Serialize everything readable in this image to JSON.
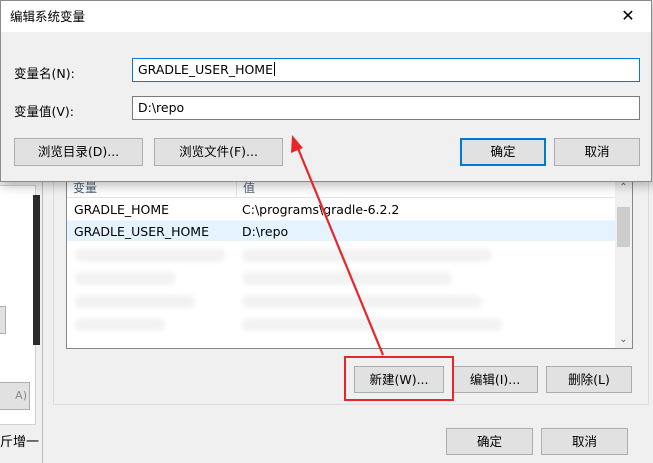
{
  "dialog": {
    "title": "编辑系统变量",
    "name_label": "变量名(N):",
    "name_value": "GRADLE_USER_HOME",
    "value_label": "变量值(V):",
    "value_value": "D:\\repo",
    "browse_dir_label": "浏览目录(D)...",
    "browse_file_label": "浏览文件(F)...",
    "ok_label": "确定",
    "cancel_label": "取消",
    "close_glyph": "✕"
  },
  "env_vars": {
    "columns": [
      "变量",
      "值"
    ],
    "rows": [
      {
        "name": "GRADLE_HOME",
        "value": "C:\\programs\\gradle-6.2.2"
      },
      {
        "name": "GRADLE_USER_HOME",
        "value": "D:\\repo"
      }
    ],
    "new_label": "新建(W)...",
    "edit_label": "编辑(I)...",
    "delete_label": "删除(L)",
    "ok_label": "确定",
    "cancel_label": "取消",
    "scroll_up": "⌃",
    "scroll_down": "⌄"
  },
  "background": {
    "left_text": "斤增一",
    "left_button": "A)"
  },
  "colors": {
    "annotation": "#e8262a",
    "focus_border": "#0078d7",
    "selected_row": "#e5f3ff"
  }
}
